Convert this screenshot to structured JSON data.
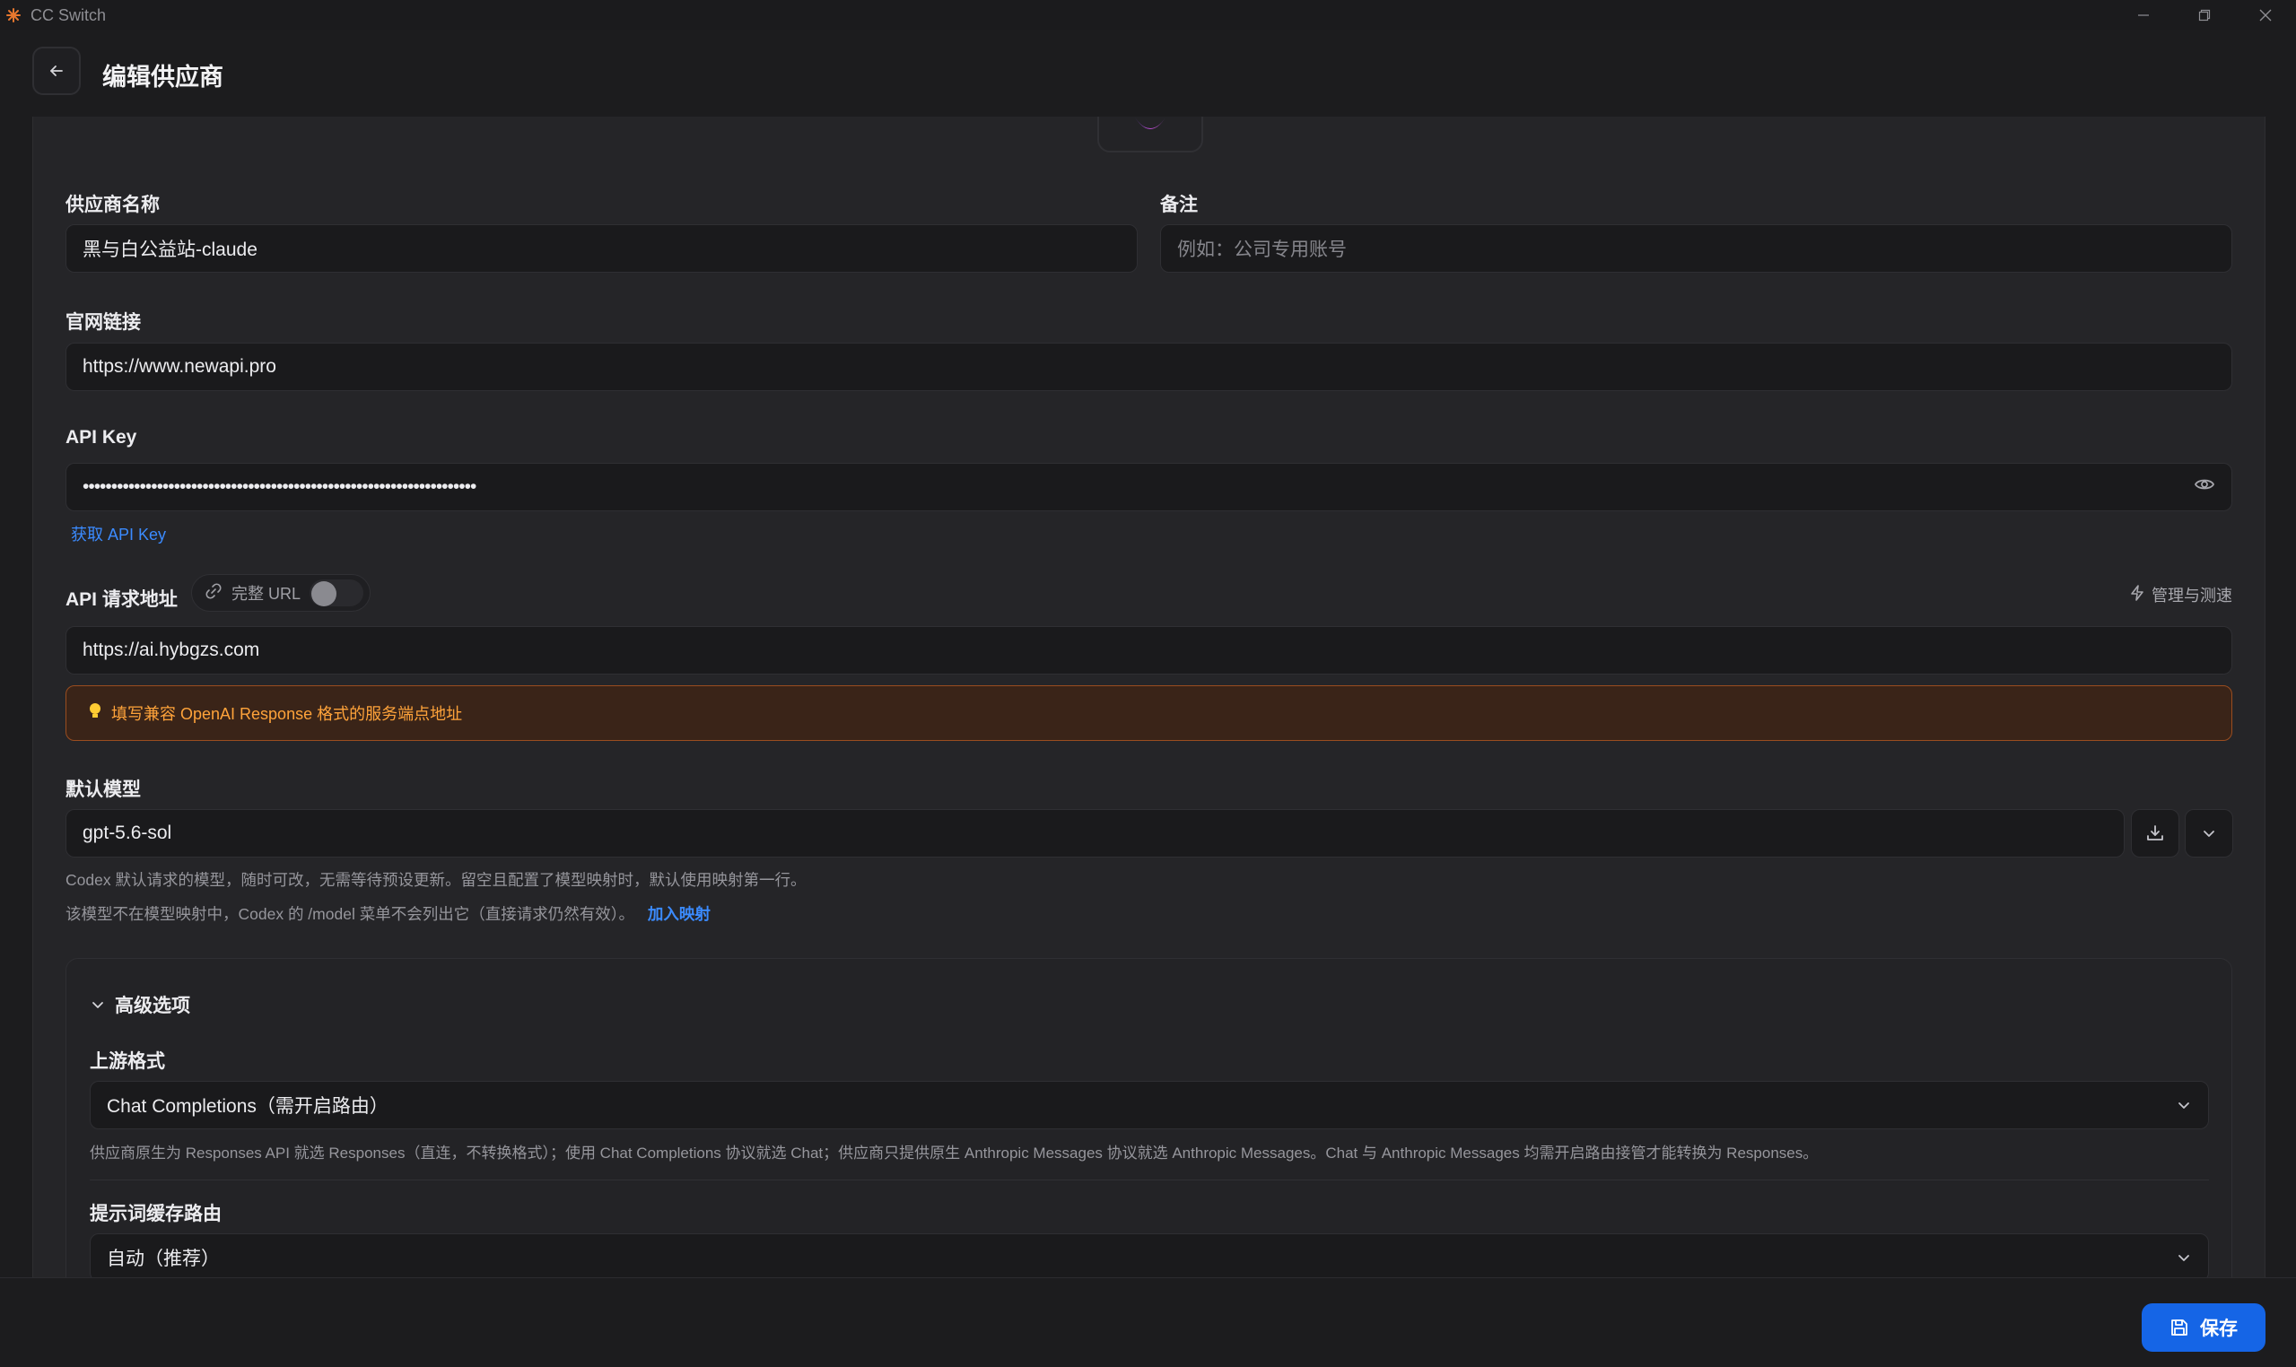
{
  "window": {
    "title": "CC Switch"
  },
  "header": {
    "title": "编辑供应商"
  },
  "form": {
    "name": {
      "label": "供应商名称",
      "value": "黑与白公益站-claude"
    },
    "note": {
      "label": "备注",
      "placeholder": "例如：公司专用账号"
    },
    "website": {
      "label": "官网链接",
      "value": "https://www.newapi.pro"
    },
    "api_key": {
      "label": "API Key",
      "value": "•••••••••••••••••••••••••••••••••••••••••••••••••••••••••••••••••••••",
      "get_link": "获取 API Key"
    },
    "endpoint": {
      "label": "API 请求地址",
      "full_url_label": "完整 URL",
      "full_url_enabled": false,
      "manage_label": "管理与测速",
      "value": "https://ai.hybgzs.com",
      "hint": "填写兼容 OpenAI Response 格式的服务端点地址"
    },
    "model": {
      "label": "默认模型",
      "value": "gpt-5.6-sol",
      "help1": "Codex 默认请求的模型，随时可改，无需等待预设更新。留空且配置了模型映射时，默认使用映射第一行。",
      "help2": "该模型不在模型映射中，Codex 的 /model 菜单不会列出它（直接请求仍然有效）。",
      "add_mapping": "加入映射"
    }
  },
  "advanced": {
    "title": "高级选项",
    "upstream": {
      "label": "上游格式",
      "value": "Chat Completions（需开启路由）",
      "help": "供应商原生为 Responses API 就选 Responses（直连，不转换格式）；使用 Chat Completions 协议就选 Chat；供应商只提供原生 Anthropic Messages 协议就选 Anthropic Messages。Chat 与 Anthropic Messages 均需开启路由接管才能转换为 Responses。"
    },
    "cache_route": {
      "label": "提示词缓存路由",
      "value": "自动（推荐）"
    }
  },
  "footer": {
    "save_label": "保存"
  },
  "colors": {
    "accent": "#1565e6",
    "link": "#3b8bff",
    "warning": "#ffa33a",
    "warning_bg": "#3a2418"
  }
}
